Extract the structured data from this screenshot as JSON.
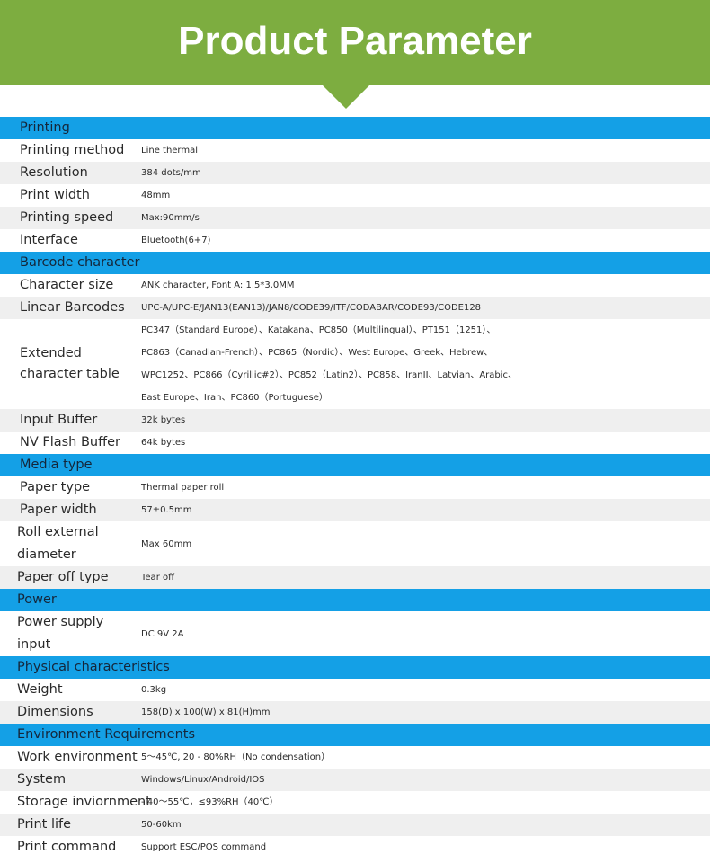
{
  "header": {
    "title": "Product Parameter"
  },
  "table": {
    "printing": {
      "title": "Printing",
      "printing_method": {
        "label": "Printing method",
        "value": "Line thermal"
      },
      "resolution": {
        "label": "Resolution",
        "value": "384 dots/mm"
      },
      "print_width": {
        "label": "Print width",
        "value": "48mm"
      },
      "printing_speed": {
        "label": "Printing speed",
        "value": "Max:90mm/s"
      },
      "interface": {
        "label": "Interface",
        "value": "Bluetooth(6+7)"
      }
    },
    "barcode": {
      "title": "Barcode character",
      "character_size": {
        "label": "Character size",
        "value": "ANK character, Font A: 1.5*3.0MM"
      },
      "linear_barcodes": {
        "label": "Linear Barcodes",
        "value": "UPC-A/UPC-E/JAN13(EAN13)/JAN8/CODE39/ITF/CODABAR/CODE93/CODE128"
      },
      "extended_table": {
        "label": "Extended character table",
        "lines": [
          "PC347（Standard Europe）、Katakana、PC850（Multilingual）、PT151（1251）、",
          "PC863（Canadian-French）、PC865（Nordic）、West Europe、Greek、Hebrew、",
          "WPC1252、PC866（Cyrillic#2）、PC852（Latin2）、PC858、IranII、Latvian、Arabic、",
          "East Europe、Iran、PC860（Portuguese）"
        ]
      },
      "input_buffer": {
        "label": "Input Buffer",
        "value": "32k bytes"
      },
      "nv_flash_buffer": {
        "label": "NV Flash Buffer",
        "value": "64k bytes"
      }
    },
    "media": {
      "title": "Media type",
      "paper_type": {
        "label": "Paper type",
        "value": "Thermal paper roll"
      },
      "paper_width": {
        "label": "Paper width",
        "value": "57±0.5mm"
      },
      "roll_diameter": {
        "label": "Roll external diameter",
        "value": "Max 60mm"
      },
      "paper_off_type": {
        "label": "Paper off type",
        "value": "Tear off"
      }
    },
    "power": {
      "title": "Power",
      "power_supply": {
        "label": "Power supply input",
        "value": "DC 9V 2A"
      }
    },
    "physical": {
      "title": "Physical characteristics",
      "weight": {
        "label": "Weight",
        "value": "0.3kg"
      },
      "dimensions": {
        "label": "Dimensions",
        "value": "158(D) x 100(W) x 81(H)mm"
      }
    },
    "environment": {
      "title": "Environment Requirements",
      "work_env": {
        "label": "Work environment",
        "value": "5～45℃, 20 - 80%RH（No condensation）"
      },
      "system": {
        "label": "System",
        "value": "Windows/Linux/Android/IOS"
      },
      "storage_env": {
        "label": "Storage inviornment",
        "value": "- 40～55℃，≤93%RH（40℃）"
      },
      "print_life": {
        "label": "Print life",
        "value": "50-60km"
      },
      "print_command": {
        "label": "Print command",
        "value": "Support ESC/POS command"
      }
    }
  },
  "colors": {
    "banner": "#7dad40",
    "section": "#14a0e6",
    "stripe": "#efefef"
  }
}
